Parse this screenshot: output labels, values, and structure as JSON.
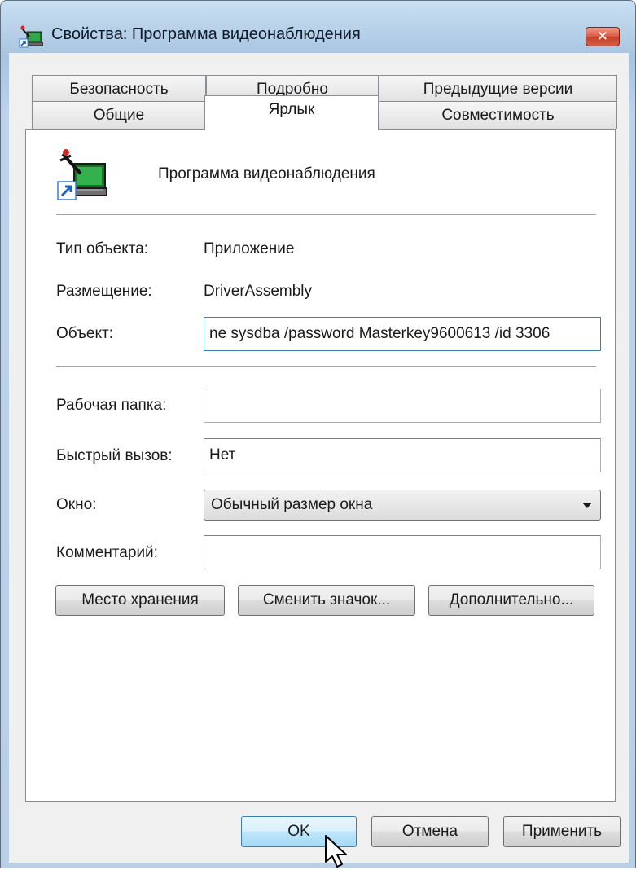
{
  "window": {
    "title": "Свойства: Программа видеонаблюдения",
    "close_glyph": "✕"
  },
  "tabs": {
    "row1": [
      "Безопасность",
      "Подробно",
      "Предыдущие версии"
    ],
    "row2": [
      "Общие",
      "Ярлык",
      "Совместимость"
    ],
    "active": "Ярлык"
  },
  "shortcut": {
    "app_name": "Программа видеонаблюдения",
    "type_label": "Тип объекта:",
    "type_value": "Приложение",
    "location_label": "Размещение:",
    "location_value": "DriverAssembly",
    "target_label": "Объект:",
    "target_value": "ne sysdba /password Masterkey9600613 /id 3306",
    "workdir_label": "Рабочая папка:",
    "workdir_value": "",
    "hotkey_label": "Быстрый вызов:",
    "hotkey_value": "Нет",
    "window_label": "Окно:",
    "window_value": "Обычный размер окна",
    "comment_label": "Комментарий:",
    "comment_value": ""
  },
  "buttons": {
    "open_location": "Место хранения",
    "change_icon": "Сменить значок...",
    "advanced": "Дополнительно...",
    "ok": "OK",
    "cancel": "Отмена",
    "apply": "Применить"
  },
  "icons": {
    "title": "app-shortcut-icon",
    "big": "app-shortcut-icon",
    "close": "close-icon",
    "cursor": "mouse-cursor-icon"
  },
  "colors": {
    "accent_blue": "#3c7fb1",
    "close_red": "#c6402a"
  }
}
